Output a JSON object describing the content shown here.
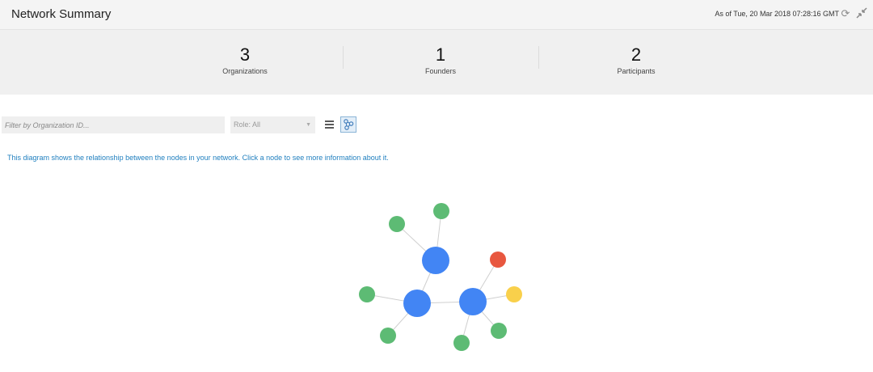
{
  "header": {
    "title": "Network Summary",
    "as_of": "As of Tue, 20 Mar 2018 07:28:16 GMT",
    "refresh_icon": "refresh-icon",
    "collapse_icon": "collapse-icon"
  },
  "summary": {
    "organizations": {
      "value": "3",
      "label": "Organizations"
    },
    "founders": {
      "value": "1",
      "label": "Founders"
    },
    "participants": {
      "value": "2",
      "label": "Participants"
    }
  },
  "filters": {
    "org_placeholder": "Filter by Organization ID...",
    "role_value": "Role: All"
  },
  "view_toggle": {
    "list_icon": "list-icon",
    "diagram_icon": "diagram-icon",
    "active": "diagram"
  },
  "info_text": "This diagram shows the relationship between the nodes in your network. Click a node to see more information about it.",
  "colors": {
    "org_node": "#4285f4",
    "peer_node": "#5dbb74",
    "orderer_node": "#e8573f",
    "ca_node": "#f9d04b",
    "edge": "#cfcfcf",
    "accent_text": "#1f7fbf"
  }
}
